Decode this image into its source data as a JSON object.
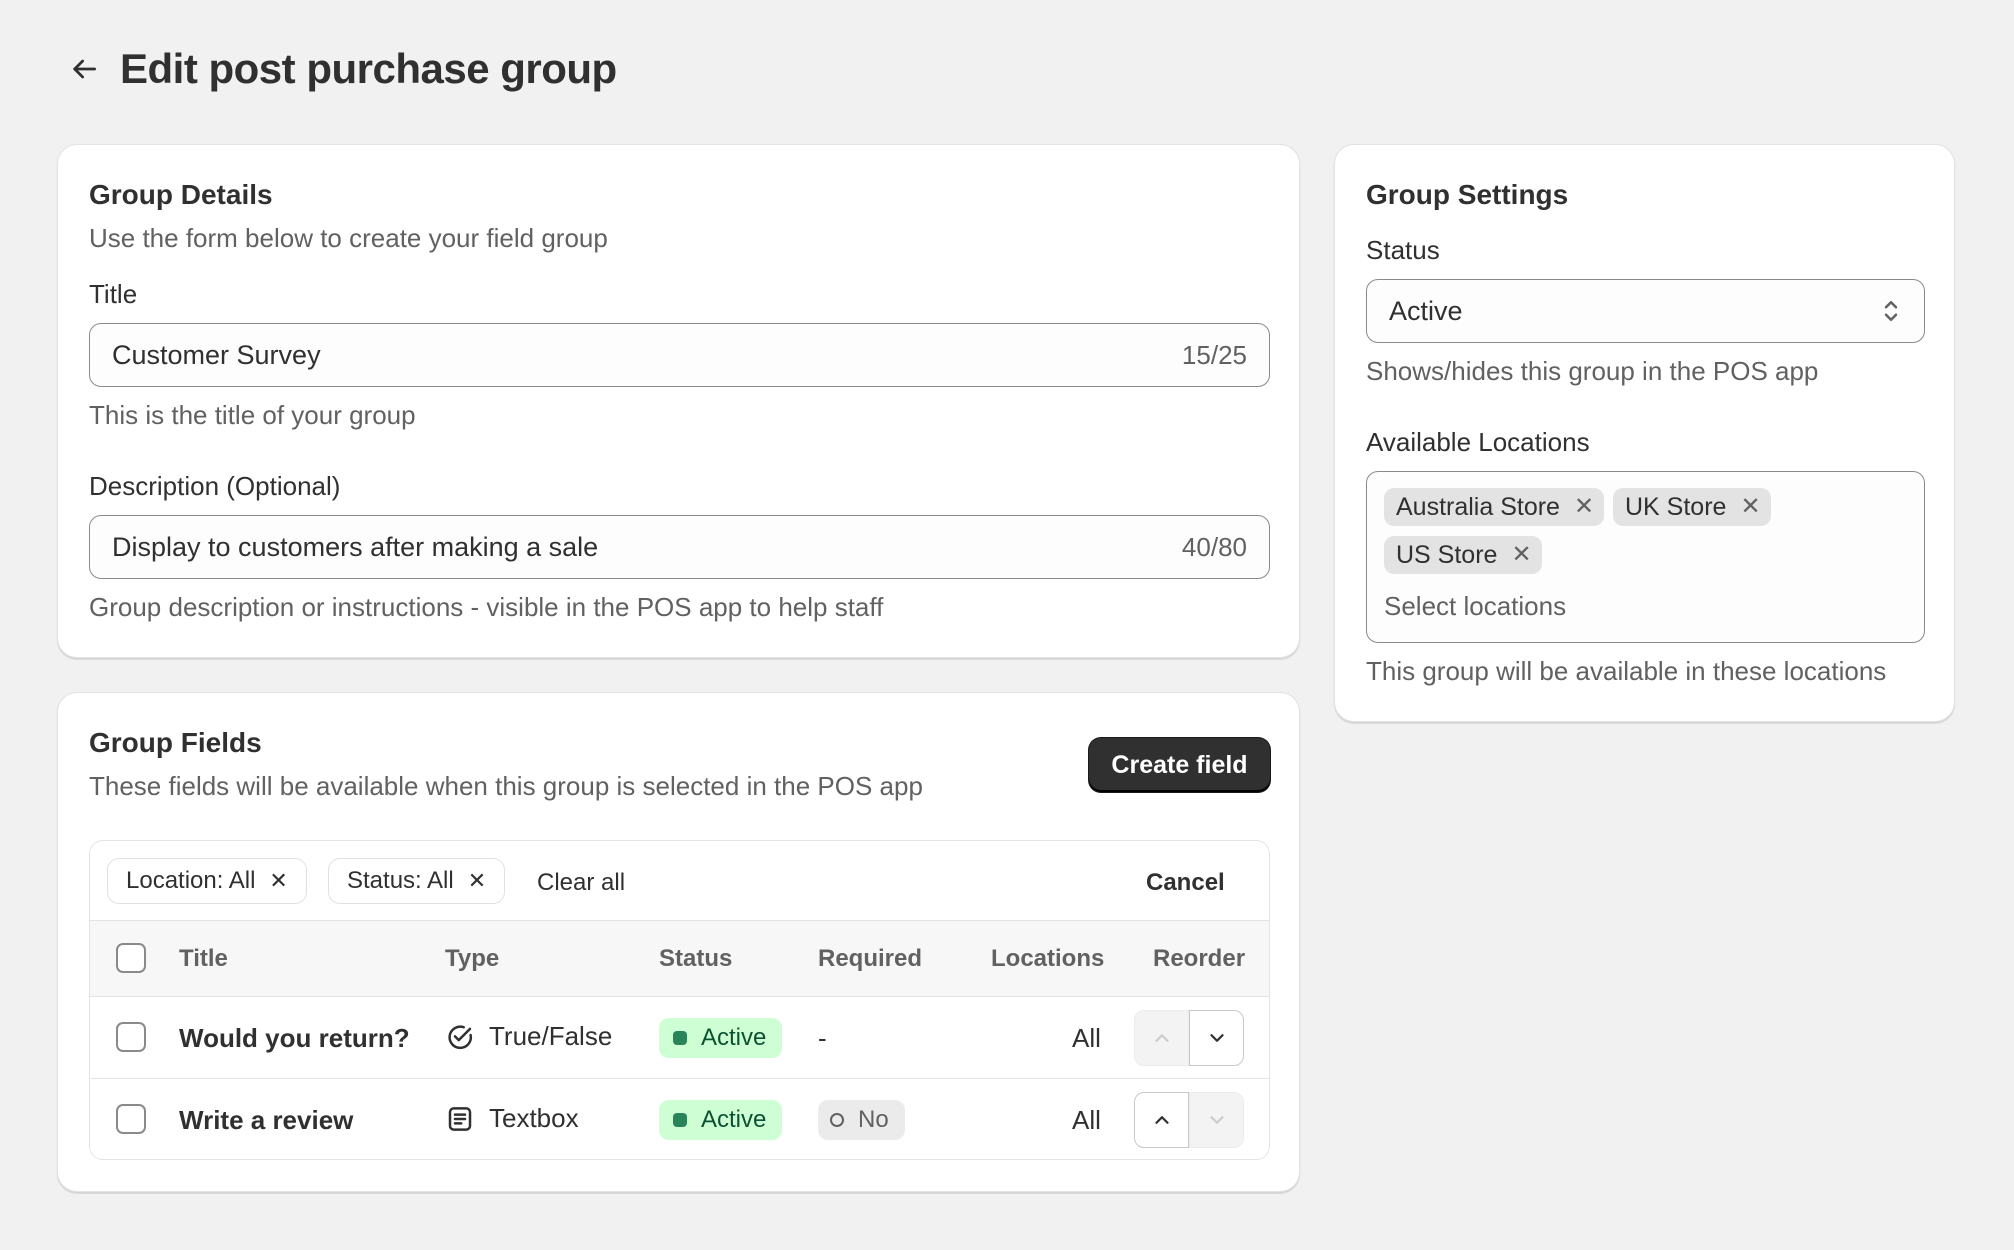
{
  "header": {
    "title": "Edit post purchase group",
    "back_icon": "arrow-left-icon"
  },
  "group_details": {
    "title": "Group Details",
    "subtitle": "Use the form below to create your field group",
    "title_field": {
      "label": "Title",
      "value": "Customer Survey",
      "counter": "15/25",
      "help": "This is the title of your group"
    },
    "description_field": {
      "label": "Description (Optional)",
      "value": "Display to customers after making a sale",
      "counter": "40/80",
      "help": "Group description or instructions - visible in the POS app to help staff"
    }
  },
  "group_fields": {
    "title": "Group Fields",
    "subtitle": "These fields will be available when this group is selected in the POS app",
    "create_button": "Create field",
    "filters": {
      "pills": [
        {
          "label": "Location: All"
        },
        {
          "label": "Status: All"
        }
      ],
      "clear_all": "Clear all",
      "cancel": "Cancel"
    },
    "table": {
      "headers": [
        "Title",
        "Type",
        "Status",
        "Required",
        "Locations",
        "Reorder"
      ],
      "rows": [
        {
          "title": "Would you return?",
          "type": "True/False",
          "type_icon": "check-circle-icon",
          "status": "Active",
          "required": "-",
          "locations": "All",
          "reorder_up_enabled": false,
          "reorder_down_enabled": true
        },
        {
          "title": "Write a review",
          "type": "Textbox",
          "type_icon": "textbox-icon",
          "status": "Active",
          "required": "No",
          "locations": "All",
          "reorder_up_enabled": true,
          "reorder_down_enabled": false
        }
      ]
    }
  },
  "group_settings": {
    "title": "Group Settings",
    "status": {
      "label": "Status",
      "value": "Active",
      "help": "Shows/hides this group in the POS app"
    },
    "locations": {
      "label": "Available Locations",
      "tags": [
        "Australia Store",
        "UK Store",
        "US Store"
      ],
      "placeholder": "Select locations",
      "help": "This group will be available in these locations"
    }
  },
  "colors": {
    "background": "#f1f1f1",
    "card": "#ffffff",
    "primary_button": "#303030",
    "success_badge_bg": "#cdfed4",
    "success_badge_text": "#0c5132",
    "success_dot": "#29845a"
  }
}
